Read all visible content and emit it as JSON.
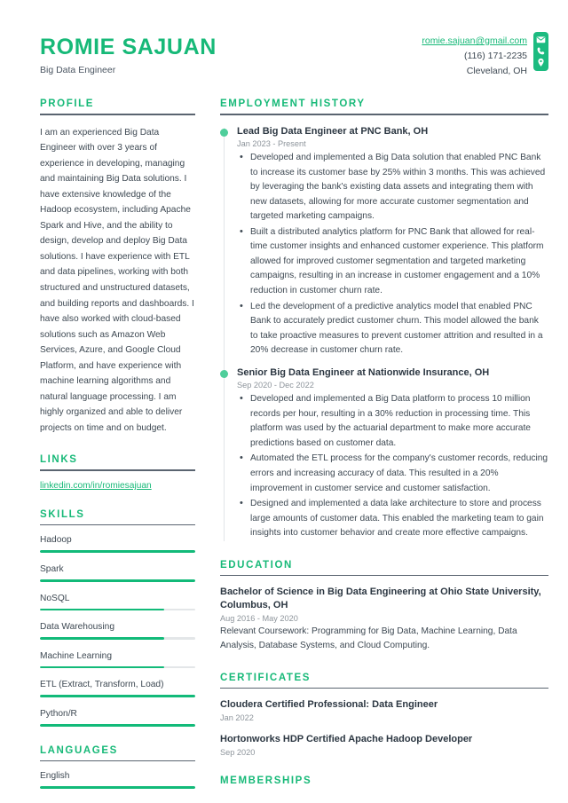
{
  "header": {
    "name": "ROMIE SAJUAN",
    "job_title": "Big Data Engineer",
    "email": "romie.sajuan@gmail.com",
    "phone": "(116) 171-2235",
    "location": "Cleveland, OH",
    "icons": [
      "envelope-icon",
      "phone-icon",
      "location-pin-icon"
    ]
  },
  "colors": {
    "accent_green": "#17b978",
    "bar_green": "#12ba79",
    "dot_green": "#4fce9b",
    "heading_rule": "#5a6470",
    "body_text": "#3d4852",
    "muted_text": "#8d949b"
  },
  "sidebar": {
    "profile": {
      "heading": "PROFILE",
      "text": "I am an experienced Big Data Engineer with over 3 years of experience in developing, managing and maintaining Big Data solutions. I have extensive knowledge of the Hadoop ecosystem, including Apache Spark and Hive, and the ability to design, develop and deploy Big Data solutions. I have experience with ETL and data pipelines, working with both structured and unstructured datasets, and building reports and dashboards. I have also worked with cloud-based solutions such as Amazon Web Services, Azure, and Google Cloud Platform, and have experience with machine learning algorithms and natural language processing. I am highly organized and able to deliver projects on time and on budget."
    },
    "links": {
      "heading": "LINKS",
      "items": [
        {
          "label": "linkedin.com/in/romiesajuan"
        }
      ]
    },
    "skills": {
      "heading": "SKILLS",
      "items": [
        {
          "name": "Hadoop",
          "level": 100
        },
        {
          "name": "Spark",
          "level": 100
        },
        {
          "name": "NoSQL",
          "level": 80
        },
        {
          "name": "Data Warehousing",
          "level": 80
        },
        {
          "name": "Machine Learning",
          "level": 80
        },
        {
          "name": "ETL (Extract, Transform, Load)",
          "level": 100
        },
        {
          "name": "Python/R",
          "level": 100
        }
      ]
    },
    "languages": {
      "heading": "LANGUAGES",
      "items": [
        {
          "name": "English",
          "level": 100
        }
      ]
    }
  },
  "main": {
    "employment": {
      "heading": "EMPLOYMENT HISTORY",
      "jobs": [
        {
          "title": "Lead Big Data Engineer at PNC Bank, OH",
          "date": "Jan 2023 - Present",
          "bullets": [
            "Developed and implemented a Big Data solution that enabled PNC Bank to increase its customer base by 25% within 3 months. This was achieved by leveraging the bank's existing data assets and integrating them with new datasets, allowing for more accurate customer segmentation and targeted marketing campaigns.",
            "Built a distributed analytics platform for PNC Bank that allowed for real-time customer insights and enhanced customer experience. This platform allowed for improved customer segmentation and targeted marketing campaigns, resulting in an increase in customer engagement and a 10% reduction in customer churn rate.",
            "Led the development of a predictive analytics model that enabled PNC Bank to accurately predict customer churn. This model allowed the bank to take proactive measures to prevent customer attrition and resulted in a 20% decrease in customer churn rate."
          ]
        },
        {
          "title": "Senior Big Data Engineer at Nationwide Insurance, OH",
          "date": "Sep 2020 - Dec 2022",
          "bullets": [
            "Developed and implemented a Big Data platform to process 10 million records per hour, resulting in a 30% reduction in processing time. This platform was used by the actuarial department to make more accurate predictions based on customer data.",
            "Automated the ETL process for the company's customer records, reducing errors and increasing accuracy of data. This resulted in a 20% improvement in customer service and customer satisfaction.",
            "Designed and implemented a data lake architecture to store and process large amounts of customer data. This enabled the marketing team to gain insights into customer behavior and create more effective campaigns."
          ]
        }
      ]
    },
    "education": {
      "heading": "EDUCATION",
      "entries": [
        {
          "title": "Bachelor of Science in Big Data Engineering at Ohio State University, Columbus, OH",
          "date": "Aug 2016 - May 2020",
          "description": "Relevant Coursework: Programming for Big Data, Machine Learning, Data Analysis, Database Systems, and Cloud Computing."
        }
      ]
    },
    "certificates": {
      "heading": "CERTIFICATES",
      "entries": [
        {
          "title": "Cloudera Certified Professional: Data Engineer",
          "date": "Jan 2022"
        },
        {
          "title": "Hortonworks HDP Certified Apache Hadoop Developer",
          "date": "Sep 2020"
        }
      ]
    },
    "memberships": {
      "heading": "MEMBERSHIPS"
    }
  }
}
